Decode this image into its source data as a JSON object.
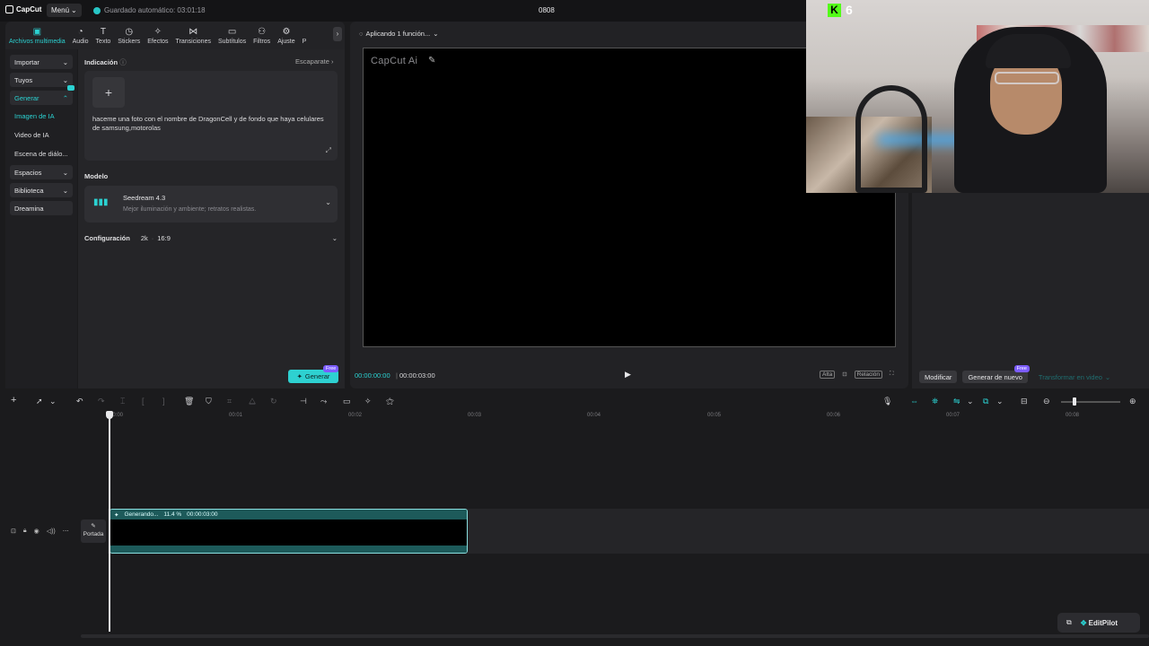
{
  "topbar": {
    "app_name": "CapCut",
    "menu_label": "Menú",
    "autosave_text": "Guardado automático: 03:01:18",
    "project_name": "0808"
  },
  "tool_tabs": [
    {
      "label": "Archivos multimedia",
      "icon": "media-icon",
      "active": true
    },
    {
      "label": "Audio",
      "icon": "audio-icon"
    },
    {
      "label": "Texto",
      "icon": "text-icon"
    },
    {
      "label": "Stickers",
      "icon": "sticker-icon"
    },
    {
      "label": "Efectos",
      "icon": "effects-icon"
    },
    {
      "label": "Transiciones",
      "icon": "transitions-icon"
    },
    {
      "label": "Subtítulos",
      "icon": "subtitles-icon"
    },
    {
      "label": "Filtros",
      "icon": "filters-icon"
    },
    {
      "label": "Ajuste",
      "icon": "adjust-icon"
    },
    {
      "label": "P",
      "icon": "more-icon"
    }
  ],
  "side_nav": {
    "importar": "Importar",
    "tuyos": "Tuyos",
    "generar": "Generar",
    "imagen_ia": "Imagen de IA",
    "video_ia": "Video de IA",
    "escena": "Escena de diálo...",
    "espacios": "Espacios",
    "biblioteca": "Biblioteca",
    "dreamina": "Dreamina"
  },
  "gen_panel": {
    "indicacion_label": "Indicación",
    "escaparate_label": "Escaparate",
    "prompt_text": "haceme una foto con el nombre de DragonCell y de fondo que haya celulares de samsung,motorolas",
    "modelo_label": "Modelo",
    "model_name": "Seedream 4.3",
    "model_desc": "Mejor iluminación y ambiente; retratos realistas.",
    "config_label": "Configuración",
    "resolution": "2k",
    "ratio": "16:9",
    "generate_label": "Generar",
    "free_badge": "Free"
  },
  "preview": {
    "applying_text": "Aplicando 1 función...",
    "canvas_watermark": "CapCut Ai",
    "time_current": "00:00:00:00",
    "time_total": "00:00:03:00",
    "btn_alta": "Alta",
    "btn_relacion": "Relación"
  },
  "right_panel": {
    "modificar": "Modificar",
    "generar_nuevo": "Generar de nuevo",
    "free_badge": "Free",
    "transformar": "Transformar en video"
  },
  "webcam": {
    "kick_count": "6"
  },
  "timeline": {
    "ticks": [
      "00:00",
      "00:01",
      "00:02",
      "00:03",
      "00:04",
      "00:05",
      "00:06",
      "00:07",
      "00:08"
    ],
    "cover_label": "Portada",
    "clip_status": "Generando...",
    "clip_progress": "11.4 %",
    "clip_duration": "00:00:03:00"
  },
  "editpilot_label": "EditPilot"
}
